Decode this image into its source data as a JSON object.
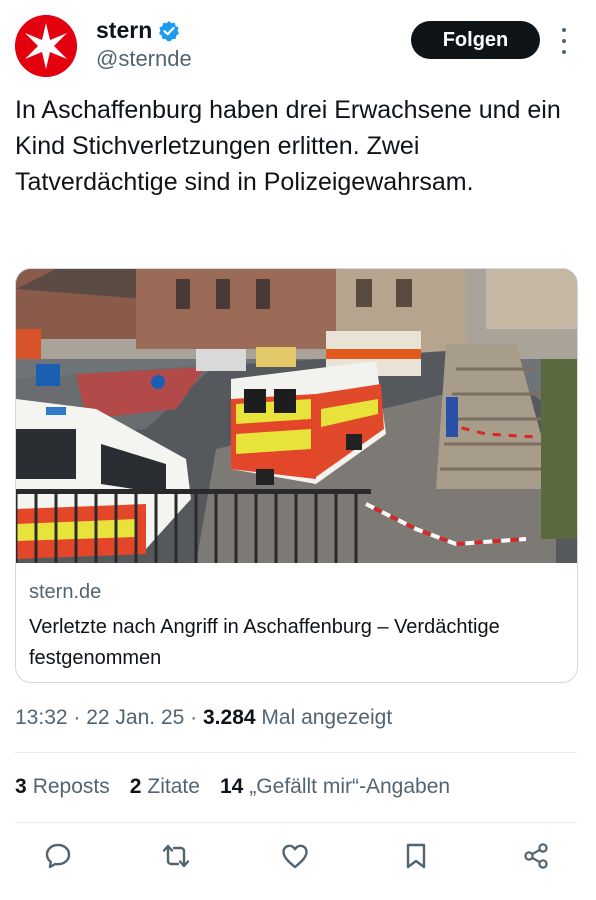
{
  "author": {
    "display_name": "stern",
    "handle": "@sternde",
    "avatar_icon": "stern-logo-icon",
    "verified_icon": "verified-badge-icon",
    "follow_label": "Folgen",
    "more_icon": "more-options-icon",
    "brand_color": "#e3000f"
  },
  "tweet": {
    "text": "In Aschaffenburg haben drei Erwachsene und ein Kind Stichverletzungen erlitten. Zwei Tatverdächtige sind in Polizeigewahrsam."
  },
  "link_card": {
    "image_description": "Rettungswagen",
    "domain": "stern.de",
    "title": "Verletzte nach Angriff in Aschaffenburg – Verdächtige festgenommen"
  },
  "meta": {
    "time": "13:32",
    "date": "22 Jan. 25",
    "views_count": "3.284",
    "views_label": "Mal angezeigt"
  },
  "stats": {
    "reposts_count": "3",
    "reposts_label": "Reposts",
    "quotes_count": "2",
    "quotes_label": "Zitate",
    "likes_count": "14",
    "likes_label": "„Gefällt mir“-Angaben"
  },
  "actions": [
    {
      "icon": "reply-icon"
    },
    {
      "icon": "retweet-icon"
    },
    {
      "icon": "like-heart-icon"
    },
    {
      "icon": "bookmark-icon"
    },
    {
      "icon": "share-icon"
    }
  ]
}
